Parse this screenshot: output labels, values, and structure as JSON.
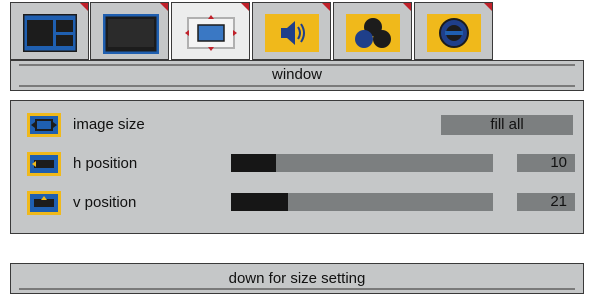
{
  "tabs": [
    {
      "icon": "display-layout-icon",
      "selected": false
    },
    {
      "icon": "monitor-icon",
      "selected": false
    },
    {
      "icon": "window-resize-icon",
      "selected": true
    },
    {
      "icon": "speaker-icon",
      "selected": false
    },
    {
      "icon": "color-circles-icon",
      "selected": false
    },
    {
      "icon": "gauge-settings-icon",
      "selected": false
    }
  ],
  "title": "window",
  "rows": {
    "image_size": {
      "label": "image size",
      "value": "fill all",
      "icon": "image-size-icon"
    },
    "h_position": {
      "label": "h position",
      "value": "10",
      "level": 10,
      "max": 100,
      "icon": "h-position-icon"
    },
    "v_position": {
      "label": "v position",
      "value": "21",
      "level": 21,
      "max": 100,
      "icon": "v-position-icon"
    }
  },
  "footer": "down for size setting",
  "colors": {
    "accent_yellow": "#f0b91b",
    "accent_blue": "#1f5fb0",
    "tab_corner_red": "#c0212a"
  }
}
